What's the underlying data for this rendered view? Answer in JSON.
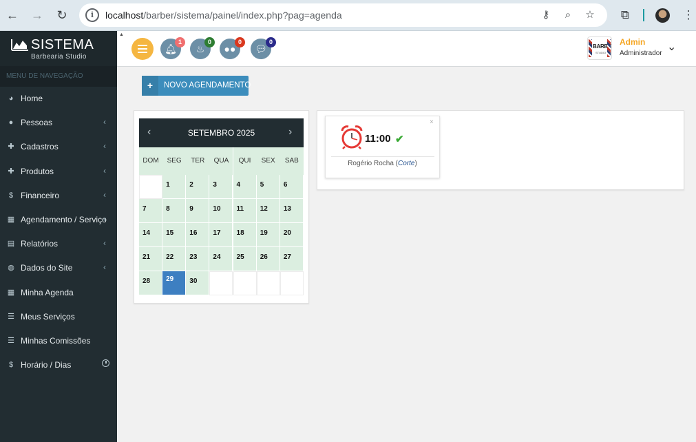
{
  "browser": {
    "url_host": "localhost",
    "url_path": "/barber/sistema/painel/index.php?pag=agenda"
  },
  "brand": {
    "title": "SISTEMA",
    "subtitle": "Barbearia Studio"
  },
  "sidebar": {
    "header": "MENU DE NAVEGAÇÃO",
    "items": [
      {
        "label": "Home",
        "icon": "dashboard-icon"
      },
      {
        "label": "Pessoas",
        "icon": "users-icon"
      },
      {
        "label": "Cadastros",
        "icon": "plus-icon"
      },
      {
        "label": "Produtos",
        "icon": "plus-icon"
      },
      {
        "label": "Financeiro",
        "icon": "dollar-icon"
      },
      {
        "label": "Agendamento / Serviço",
        "icon": "calendar-icon"
      },
      {
        "label": "Relatórios",
        "icon": "pdf-icon"
      },
      {
        "label": "Dados do Site",
        "icon": "globe-icon"
      },
      {
        "label": "Minha Agenda",
        "icon": "calendar-icon"
      },
      {
        "label": "Meus Serviços",
        "icon": "server-icon"
      },
      {
        "label": "Minhas Comissões",
        "icon": "server-icon"
      },
      {
        "label": "Horário / Dias",
        "icon": "dollar-icon"
      }
    ]
  },
  "topbar": {
    "badges": {
      "notifications": "1",
      "birthdays": "0",
      "clients": "0",
      "messages": "0"
    },
    "user_logo_text": "BARBER",
    "user_logo_sub": "STUDIO",
    "user_name": "Admin",
    "user_role": "Administrador"
  },
  "actions": {
    "new_appointment": "NOVO AGENDAMENTO"
  },
  "calendar": {
    "month_title": "SETEMBRO 2025",
    "weekdays": [
      "DOM",
      "SEG",
      "TER",
      "QUA",
      "QUI",
      "SEX",
      "SAB"
    ],
    "first_weekday_index": 1,
    "days_in_month": 30,
    "today": 29
  },
  "event": {
    "time": "11:00",
    "check": "✔",
    "close": "×",
    "client": "Rogério Rocha",
    "service": "Corte"
  },
  "colors": {
    "sidebar_bg": "#222d32",
    "accent": "#3c8dbc",
    "calendar_day_bg": "#dbeee0",
    "today_bg": "#3d7fc1",
    "user_name": "#f5a623"
  }
}
